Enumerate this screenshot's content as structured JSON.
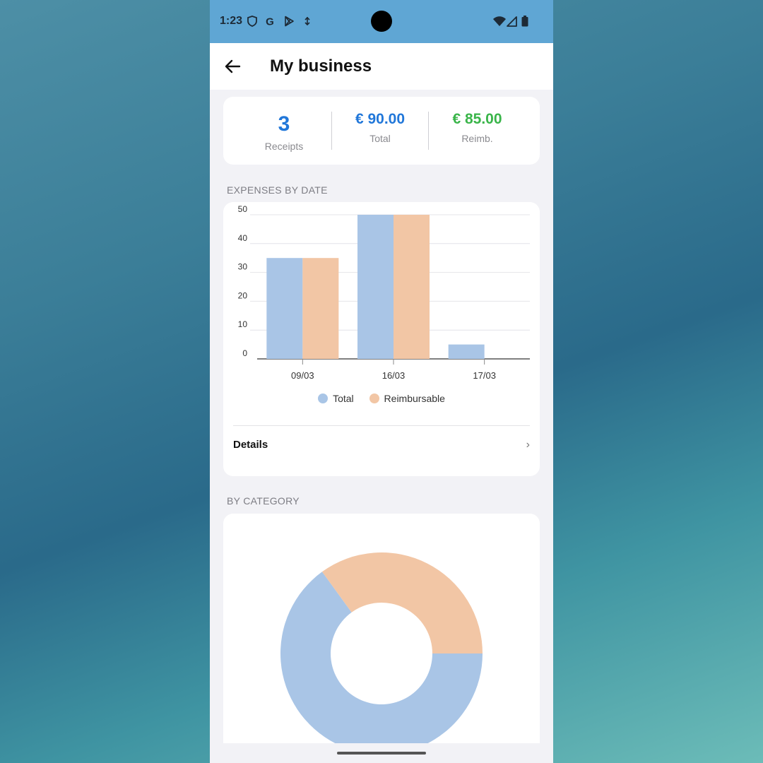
{
  "status_bar": {
    "time": "1:23",
    "icons": [
      "shield-icon",
      "google-icon",
      "play-store-icon",
      "usb-icon",
      "wifi-icon",
      "signal-icon",
      "battery-icon"
    ]
  },
  "app_bar": {
    "title": "My business",
    "back_icon": "arrow-left-icon"
  },
  "summary": {
    "receipts": {
      "value": "3",
      "label": "Receipts"
    },
    "total": {
      "value": "€ 90.00",
      "label": "Total"
    },
    "reimb": {
      "value": "€ 85.00",
      "label": "Reimb."
    }
  },
  "colors": {
    "accent_blue": "#2177d9",
    "accent_green": "#3ab54a",
    "series_total": "#a9c5e6",
    "series_reimbursable": "#f2c6a5",
    "status_bar": "#5fa6d4"
  },
  "expenses_by_date": {
    "header": "EXPENSES BY DATE",
    "details_label": "Details"
  },
  "by_category": {
    "header": "BY CATEGORY"
  },
  "chart_data": [
    {
      "type": "bar",
      "categories": [
        "09/03",
        "16/03",
        "17/03"
      ],
      "series": [
        {
          "name": "Total",
          "values": [
            35,
            50,
            5
          ]
        },
        {
          "name": "Reimbursable",
          "values": [
            35,
            50,
            0
          ]
        }
      ],
      "ytick_labels": [
        "0",
        "10",
        "20",
        "30",
        "40",
        "50"
      ],
      "ylim": [
        0,
        50
      ],
      "grid": true,
      "legend": "bottom"
    },
    {
      "type": "pie",
      "donut": true,
      "slices": [
        {
          "value": 65,
          "color": "#a9c5e6"
        },
        {
          "value": 35,
          "color": "#f2c6a5"
        }
      ]
    }
  ]
}
